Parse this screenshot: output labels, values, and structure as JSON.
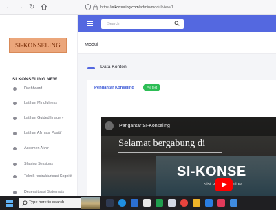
{
  "browser": {
    "url_prefix": "https://",
    "url_host": "sikonseling.com",
    "url_path": "/admin/modul/view/1"
  },
  "sidebar": {
    "logo_text": "SI-KONSELING",
    "brand_label": "SI KONSELING NEW",
    "items": [
      {
        "label": "Dashboard"
      },
      {
        "label": "Latihan Mindfulness"
      },
      {
        "label": "Latihan Guided Imagery"
      },
      {
        "label": "Latihan Afirmasi Positif"
      },
      {
        "label": "Asesmen Akhir"
      },
      {
        "label": "Sharing Sessions"
      },
      {
        "label": "Teknik restrukturisasi Kognitif"
      },
      {
        "label": "Desensitisasi Sistematis"
      }
    ]
  },
  "topbar": {
    "search_placeholder": "Search"
  },
  "page": {
    "title": "Modul",
    "section_title": "Data Konten"
  },
  "content": {
    "post_link": "Pengantar Konseling",
    "badge": "Pre test"
  },
  "video": {
    "channel_initial": "I",
    "title": "Pengantar SI-Konseling",
    "welcome_text": "Selamat bergabung di",
    "brand_text": "SI-KONSE",
    "sub_text": "sist          edukasi online"
  },
  "taskbar": {
    "search_text": "Type here to search"
  },
  "colors": {
    "accent": "#5468e0",
    "badge": "#2dbd55",
    "logo_bg": "#eba67b",
    "play_button": "#ff0000"
  }
}
